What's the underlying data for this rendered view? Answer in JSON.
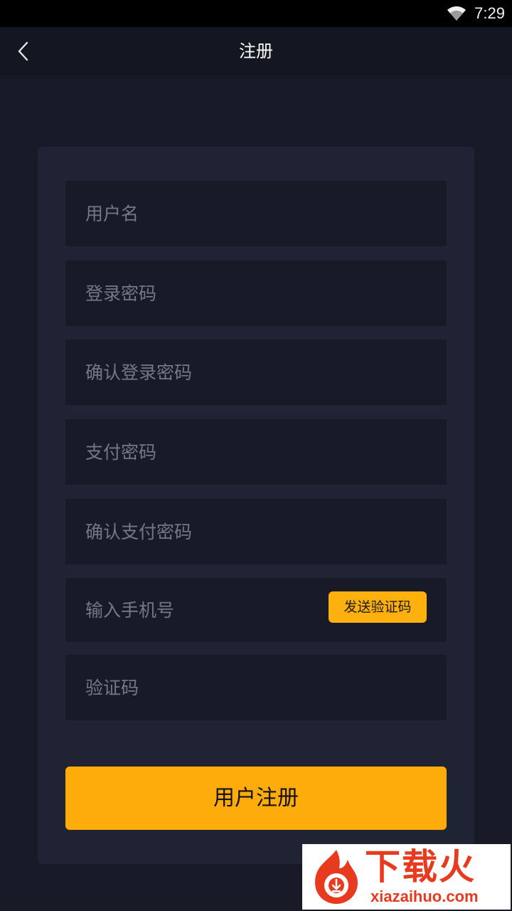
{
  "status_bar": {
    "time": "7:29"
  },
  "header": {
    "title": "注册",
    "back_icon": "chevron-left-icon"
  },
  "form": {
    "fields": [
      {
        "placeholder": "用户名",
        "value": ""
      },
      {
        "placeholder": "登录密码",
        "value": ""
      },
      {
        "placeholder": "确认登录密码",
        "value": ""
      },
      {
        "placeholder": "支付密码",
        "value": ""
      },
      {
        "placeholder": "确认支付密码",
        "value": ""
      },
      {
        "placeholder": "输入手机号",
        "value": ""
      },
      {
        "placeholder": "验证码",
        "value": ""
      }
    ],
    "send_code_label": "发送验证码",
    "submit_label": "用户注册"
  },
  "watermark": {
    "brand": "下载火",
    "domain": "xiazaihuo.com"
  },
  "colors": {
    "background": "#181b27",
    "card": "#1f2333",
    "accent": "#fdac0c",
    "watermark": "#e83a1e"
  }
}
